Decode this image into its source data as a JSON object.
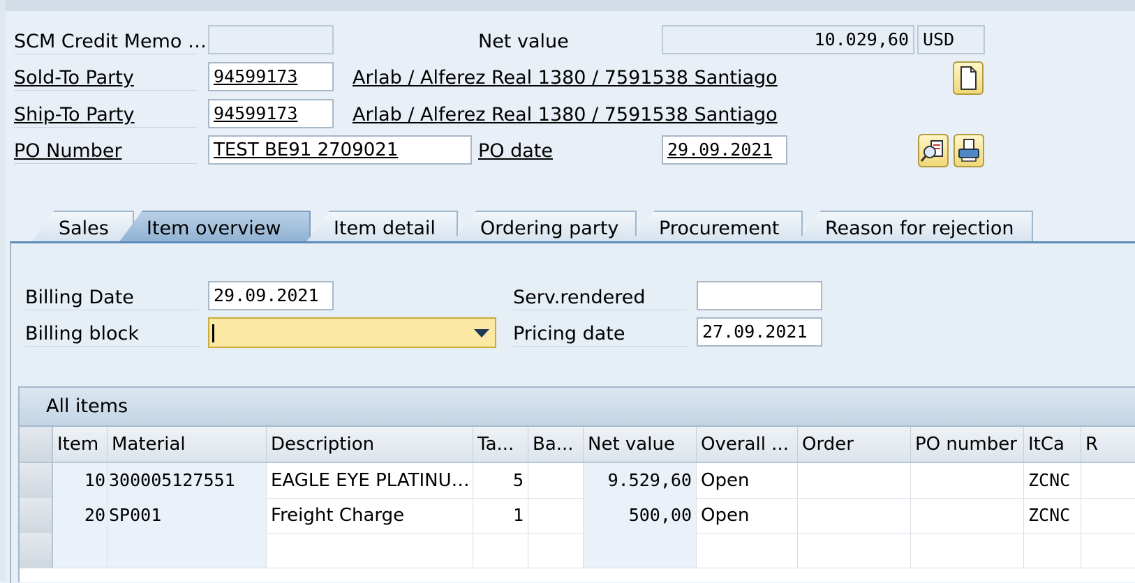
{
  "header": {
    "doc_label": "SCM Credit Memo …",
    "doc_value": "",
    "net_value_label": "Net value",
    "net_value": "10.029,60",
    "currency": "USD",
    "sold_to_label": "Sold-To Party",
    "sold_to_value": "94599173",
    "sold_to_address": "Arlab / Alferez Real 1380 / 7591538 Santiago",
    "ship_to_label": "Ship-To Party",
    "ship_to_value": "94599173",
    "ship_to_address": "Arlab / Alferez Real 1380 / 7591538 Santiago",
    "po_number_label": "PO Number",
    "po_number_value": "TEST BE91 2709021",
    "po_date_label": "PO date",
    "po_date_value": "29.09.2021"
  },
  "tabs": [
    {
      "label": "Sales",
      "active": false
    },
    {
      "label": "Item overview",
      "active": true
    },
    {
      "label": "Item detail",
      "active": false
    },
    {
      "label": "Ordering party",
      "active": false
    },
    {
      "label": "Procurement",
      "active": false
    },
    {
      "label": "Reason for rejection",
      "active": false
    }
  ],
  "item_overview": {
    "billing_date_label": "Billing Date",
    "billing_date_value": "29.09.2021",
    "billing_block_label": "Billing block",
    "billing_block_value": "",
    "serv_rendered_label": "Serv.rendered",
    "serv_rendered_value": "",
    "pricing_date_label": "Pricing date",
    "pricing_date_value": "27.09.2021"
  },
  "table": {
    "title": "All items",
    "columns": [
      "Item",
      "Material",
      "Description",
      "Ta...",
      "Ba...",
      "Net value",
      "Overall ...",
      "Order",
      "PO number",
      "ItCa",
      "R"
    ],
    "rows": [
      [
        "10",
        "300005127551",
        "EAGLE EYE PLATINU…",
        "5",
        "",
        "9.529,60",
        "Open",
        "",
        "",
        "ZCNC",
        ""
      ],
      [
        "20",
        "SP001",
        "Freight Charge",
        "1",
        "",
        "500,00",
        "Open",
        "",
        "",
        "ZCNC",
        ""
      ],
      [
        "",
        "",
        "",
        "",
        "",
        "",
        "",
        "",
        "",
        "",
        ""
      ]
    ]
  },
  "icons": {
    "new_doc": "document-icon",
    "display_po": "magnify-document-icon",
    "print_po": "printer-icon"
  }
}
